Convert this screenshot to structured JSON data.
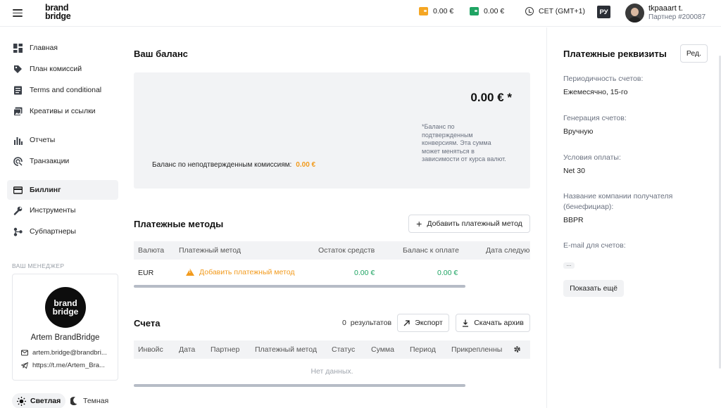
{
  "header": {
    "logo": [
      "brand",
      "bridge"
    ],
    "balance1": "0.00 €",
    "balance2": "0.00 €",
    "timezone": "CET (GMT+1)",
    "lang": "РУ",
    "user_name": "tkpaaart t.",
    "user_partner": "Партнер #200087",
    "colors": {
      "wallet1": "#f5a623",
      "wallet2": "#1fa463"
    }
  },
  "sidebar": {
    "items": [
      {
        "label": "Главная",
        "icon": "dashboard-icon"
      },
      {
        "label": "План комиссий",
        "icon": "tag-icon"
      },
      {
        "label": "Terms and conditional",
        "icon": "document-icon"
      },
      {
        "label": "Креативы и ссылки",
        "icon": "images-icon"
      },
      {
        "label": "Отчеты",
        "icon": "bar-chart-icon"
      },
      {
        "label": "Транзакции",
        "icon": "transactions-icon"
      },
      {
        "label": "Биллинг",
        "icon": "credit-card-icon"
      },
      {
        "label": "Инструменты",
        "icon": "wrench-icon"
      },
      {
        "label": "Субпартнеры",
        "icon": "network-icon"
      }
    ],
    "manager_title": "ВАШ МЕНЕДЖЕР",
    "manager": {
      "logo": [
        "brand",
        "bridge"
      ],
      "name": "Artem BrandBridge",
      "email": "artem.bridge@brandbri...",
      "telegram": "https://t.me/Artem_Bra..."
    },
    "theme_light": "Светлая",
    "theme_dark": "Темная"
  },
  "balance": {
    "title": "Ваш баланс",
    "amount": "0.00 € *",
    "note": "*Баланс по подтвержденным конверсиям. Эта сумма может меняться в зависимости от курса валют.",
    "unconfirmed_label": "Баланс по неподтвержденным комиссиям:",
    "unconfirmed_value": "0.00 €"
  },
  "payment_methods": {
    "title": "Платежные методы",
    "add_button": "Добавить платежный метод",
    "columns": [
      "Валюта",
      "Платежный метод",
      "Остаток средств",
      "Баланс к оплате",
      "Дата следую"
    ],
    "row": {
      "currency": "EUR",
      "method": "Добавить платежный метод",
      "remaining": "0.00 €",
      "to_pay": "0.00 €"
    }
  },
  "invoices": {
    "title": "Счета",
    "count": "0",
    "results_label": "результатов",
    "export_button": "Экспорт",
    "archive_button": "Скачать архив",
    "columns": [
      "Инвойс",
      "Дата",
      "Партнер",
      "Платежный метод",
      "Статус",
      "Сумма",
      "Период",
      "Прикрепленны"
    ],
    "empty": "Нет данных."
  },
  "requisites": {
    "title": "Платежные реквизиты",
    "edit_button": "Ред.",
    "fields": [
      {
        "label": "Периодичность счетов:",
        "value": "Ежемесячно, 15-го"
      },
      {
        "label": "Генерация счетов:",
        "value": "Вручную"
      },
      {
        "label": "Условия оплаты:",
        "value": "Net 30"
      },
      {
        "label": "Название компании получателя (бенефициар):",
        "value": "BBPR"
      },
      {
        "label": "E-mail для счетов:",
        "value": ""
      }
    ],
    "dots": "...",
    "show_more": "Показать ещё"
  },
  "colors": {
    "accent_orange": "#f29a1c",
    "green": "#1fa463"
  }
}
